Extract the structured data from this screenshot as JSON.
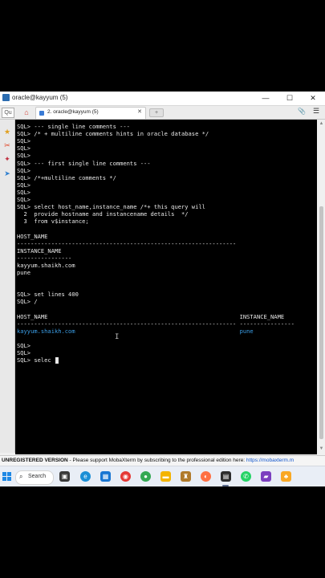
{
  "window": {
    "title": "oracle@kayyum (5)",
    "minimize": "—",
    "maximize": "☐",
    "close": "✕"
  },
  "tabs": {
    "quick_connect": "Qu",
    "active_tab": "2. oracle@kayyum (5)",
    "close": "✕"
  },
  "terminal": {
    "lines": [
      "SQL> --- single line comments ---",
      "SQL> /* + multiline comments hints in oracle database */",
      "SQL>",
      "SQL>",
      "SQL>",
      "SQL> --- first single line comments ---",
      "SQL>",
      "SQL> /*+multiline comments */",
      "SQL>",
      "SQL>",
      "SQL>",
      "SQL> select host_name,instance_name /*+ this query will",
      "  2  provide hostname and instancename details  */",
      "  3  from v$instance;",
      "",
      "HOST_NAME",
      "----------------------------------------------------------------",
      "INSTANCE_NAME",
      "----------------",
      "kayyum.shaikh.com",
      "pune",
      "",
      "",
      "SQL> set lines 400",
      "SQL> /",
      "",
      "HOST_NAME                                                        INSTANCE_NAME",
      "---------------------------------------------------------------- ----------------",
      "kayyum.shaikh.com                                                pune",
      "",
      "SQL>",
      "SQL>",
      "SQL> selec"
    ]
  },
  "statusbar": {
    "label": "UNREGISTERED VERSION",
    "message": "  -  Please support MobaXterm by subscribing to the professional edition here: ",
    "link": "https://mobaxterm.m"
  },
  "taskbar": {
    "search_label": "Search"
  },
  "colors": {
    "terminal_bg": "#000000",
    "terminal_fg": "#e8e8e8",
    "link_blue": "#3b9fe8"
  }
}
